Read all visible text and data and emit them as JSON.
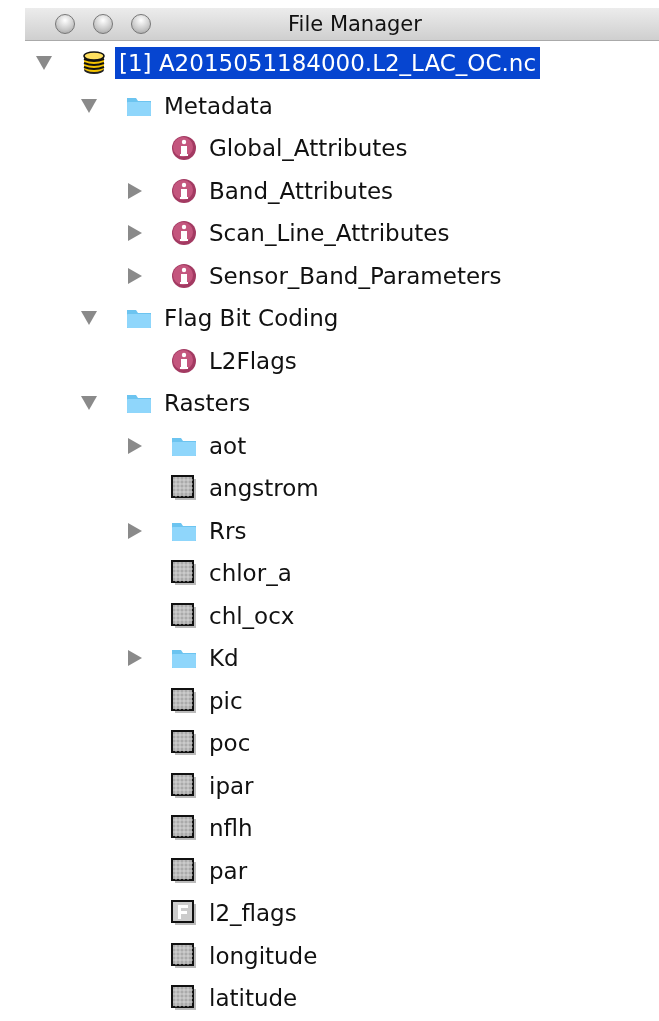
{
  "window": {
    "title": "File Manager"
  },
  "tree": [
    {
      "label": "[1] A2015051184000.L2_LAC_OC.nc",
      "kind": "product",
      "expanded": true,
      "selected": true,
      "children": [
        {
          "label": "Metadata",
          "kind": "folder",
          "expanded": true,
          "selected": false,
          "children": [
            {
              "label": "Global_Attributes",
              "kind": "info",
              "selected": false
            },
            {
              "label": "Band_Attributes",
              "kind": "info",
              "expanded": false,
              "selected": false
            },
            {
              "label": "Scan_Line_Attributes",
              "kind": "info",
              "expanded": false,
              "selected": false
            },
            {
              "label": "Sensor_Band_Parameters",
              "kind": "info",
              "expanded": false,
              "selected": false
            }
          ]
        },
        {
          "label": "Flag Bit Coding",
          "kind": "folder",
          "expanded": true,
          "selected": false,
          "children": [
            {
              "label": "L2Flags",
              "kind": "info",
              "selected": false
            }
          ]
        },
        {
          "label": "Rasters",
          "kind": "folder",
          "expanded": true,
          "selected": false,
          "children": [
            {
              "label": "aot",
              "kind": "folder",
              "expanded": false,
              "selected": false
            },
            {
              "label": "angstrom",
              "kind": "band",
              "selected": false
            },
            {
              "label": "Rrs",
              "kind": "folder",
              "expanded": false,
              "selected": false
            },
            {
              "label": "chlor_a",
              "kind": "band",
              "selected": false
            },
            {
              "label": "chl_ocx",
              "kind": "band",
              "selected": false
            },
            {
              "label": "Kd",
              "kind": "folder",
              "expanded": false,
              "selected": false
            },
            {
              "label": "pic",
              "kind": "band",
              "selected": false
            },
            {
              "label": "poc",
              "kind": "band",
              "selected": false
            },
            {
              "label": "ipar",
              "kind": "band",
              "selected": false
            },
            {
              "label": "nflh",
              "kind": "band",
              "selected": false
            },
            {
              "label": "par",
              "kind": "band",
              "selected": false
            },
            {
              "label": "l2_flags",
              "kind": "flag",
              "selected": false
            },
            {
              "label": "longitude",
              "kind": "band",
              "selected": false
            },
            {
              "label": "latitude",
              "kind": "band",
              "selected": false
            }
          ]
        }
      ]
    }
  ]
}
